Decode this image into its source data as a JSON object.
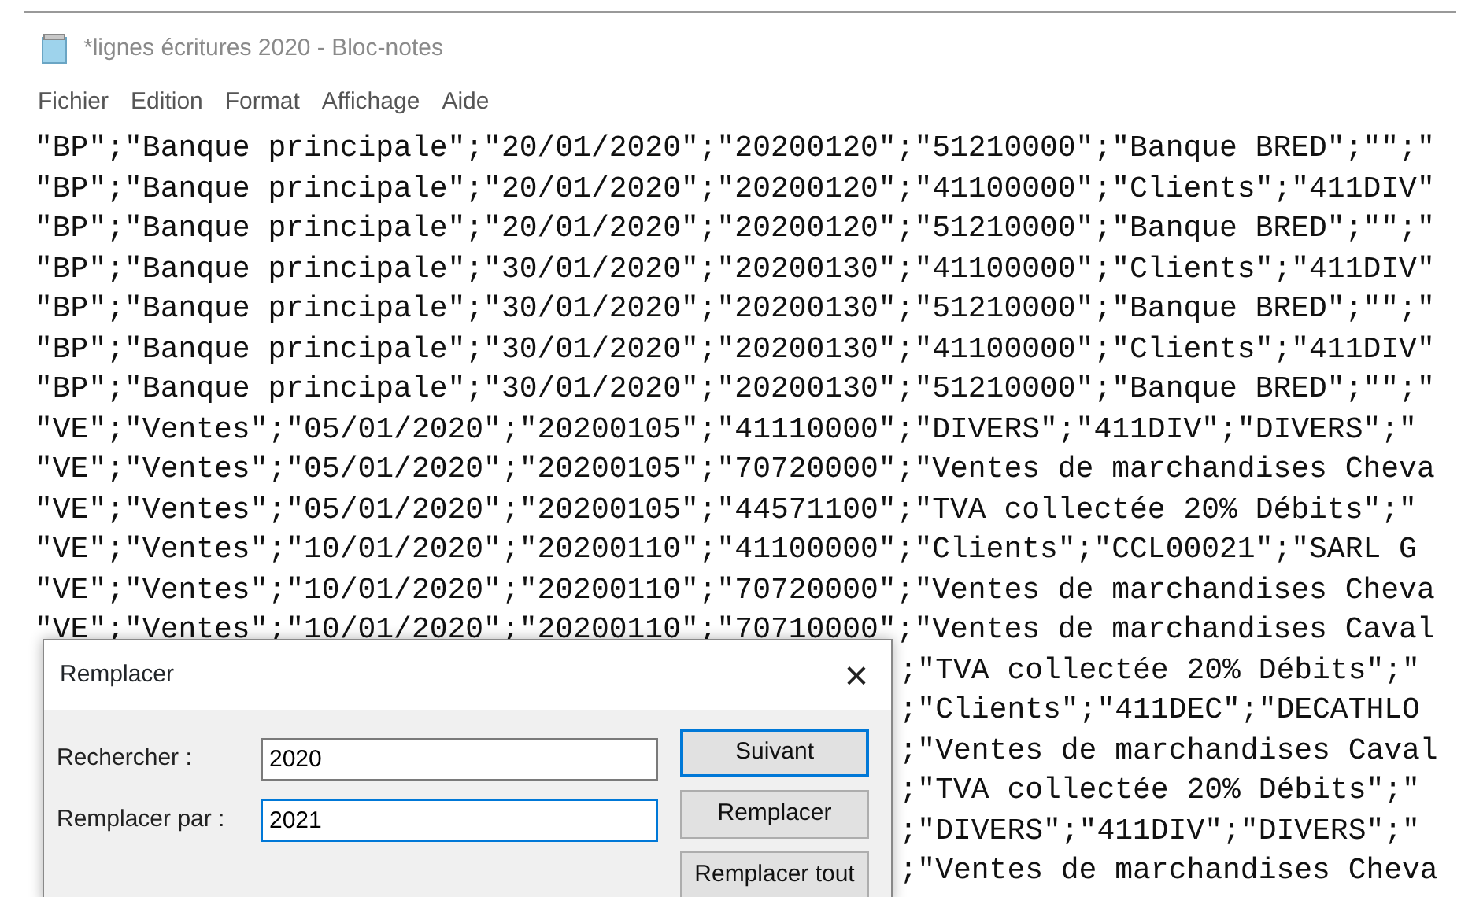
{
  "window": {
    "title": "*lignes écritures 2020 - Bloc-notes"
  },
  "menu": [
    "Fichier",
    "Edition",
    "Format",
    "Affichage",
    "Aide"
  ],
  "lines": [
    {
      "text": "\"BP\";\"Banque principale\";\"20/01/2020\";\"20200120\";\"51210000\";\"Banque BRED\";\"\";\""
    },
    {
      "text": "\"BP\";\"Banque principale\";\"20/01/2020\";\"20200120\";\"41100000\";\"Clients\";\"411DIV\""
    },
    {
      "text": "\"BP\";\"Banque principale\";\"20/01/2020\";\"20200120\";\"51210000\";\"Banque BRED\";\"\";\""
    },
    {
      "text": "\"BP\";\"Banque principale\";\"30/01/2020\";\"20200130\";\"41100000\";\"Clients\";\"411DIV\""
    },
    {
      "text": "\"BP\";\"Banque principale\";\"30/01/2020\";\"20200130\";\"51210000\";\"Banque BRED\";\"\";\""
    },
    {
      "text": "\"BP\";\"Banque principale\";\"30/01/2020\";\"20200130\";\"41100000\";\"Clients\";\"411DIV\""
    },
    {
      "text": "\"BP\";\"Banque principale\";\"30/01/2020\";\"20200130\";\"51210000\";\"Banque BRED\";\"\";\""
    },
    {
      "text": "\"VE\";\"Ventes\";\"05/01/2020\";\"20200105\";\"41110000\";\"DIVERS\";\"411DIV\";\"DIVERS\";\""
    },
    {
      "text": "\"VE\";\"Ventes\";\"05/01/2020\";\"20200105\";\"70720000\";\"Ventes de marchandises Cheva"
    },
    {
      "text": "\"VE\";\"Ventes\";\"05/01/2020\";\"20200105\";\"44571100\";\"TVA collectée 20% Débits\";\""
    },
    {
      "text": "\"VE\";\"Ventes\";\"10/01/2020\";\"20200110\";\"41100000\";\"Clients\";\"CCL00021\";\"SARL G"
    },
    {
      "text": "\"VE\";\"Ventes\";\"10/01/2020\";\"20200110\";\"70720000\";\"Ventes de marchandises Cheva"
    },
    {
      "text": "\"VE\";\"Ventes\";\"10/01/2020\";\"20200110\";\"70710000\";\"Ventes de marchandises Caval"
    },
    {
      "tail": ";\"TVA collectée 20% Débits\";\""
    },
    {
      "tail": ";\"Clients\";\"411DEC\";\"DECATHLO"
    },
    {
      "tail": ";\"Ventes de marchandises Caval"
    },
    {
      "tail": ";\"TVA collectée 20% Débits\";\""
    },
    {
      "tail": ";\"DIVERS\";\"411DIV\";\"DIVERS\";\""
    },
    {
      "tail": ";\"Ventes de marchandises Cheva"
    }
  ],
  "dialog": {
    "title": "Remplacer",
    "close": "×",
    "fields": [
      {
        "label": "Rechercher :",
        "value": "2020",
        "focused": false
      },
      {
        "label": "Remplacer par :",
        "value": "2021",
        "focused": true
      }
    ],
    "buttons": [
      {
        "label": "Suivant",
        "default": true
      },
      {
        "label": "Remplacer",
        "default": false
      },
      {
        "label": "Remplacer tout",
        "default": false
      }
    ]
  }
}
